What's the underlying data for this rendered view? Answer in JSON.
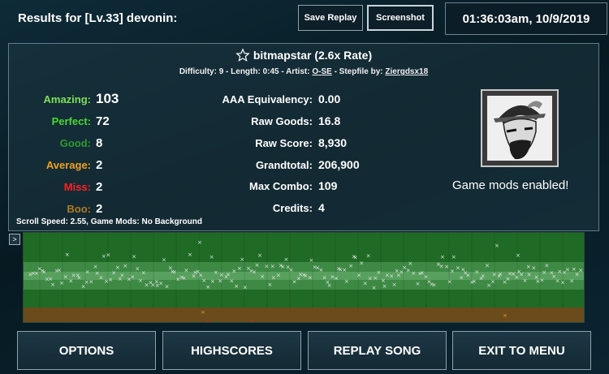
{
  "header": {
    "title": "Results for [Lv.33] devonin:",
    "save_replay_label": "Save Replay",
    "screenshot_label": "Screenshot",
    "datetime": "01:36:03am, 10/9/2019"
  },
  "song": {
    "name": "bitmapstar (2.6x Rate)",
    "meta_prefix": "Difficulty: 9 - Length: 0:45 - Artist:",
    "artist": "O-SE",
    "stepfile_prefix": "- Stepfile by:",
    "stepfile_author": "Ziergdsx18"
  },
  "judgements": [
    {
      "label": "Amazing:",
      "value": "103",
      "color": "#7fe05a"
    },
    {
      "label": "Perfect:",
      "value": "72",
      "color": "#4cd832"
    },
    {
      "label": "Good:",
      "value": "8",
      "color": "#2e9b2e"
    },
    {
      "label": "Average:",
      "value": "2",
      "color": "#f0a020"
    },
    {
      "label": "Miss:",
      "value": "2",
      "color": "#ff2020"
    },
    {
      "label": "Boo:",
      "value": "2",
      "color": "#b07a22"
    }
  ],
  "stats": [
    {
      "label": "AAA Equivalency:",
      "value": "0.00"
    },
    {
      "label": "Raw Goods:",
      "value": "16.8"
    },
    {
      "label": "Raw Score:",
      "value": "8,930"
    },
    {
      "label": "Grandtotal:",
      "value": "206,900"
    },
    {
      "label": "Max Combo:",
      "value": "109"
    },
    {
      "label": "Credits:",
      "value": "4"
    }
  ],
  "mods_text": "Game mods enabled!",
  "scroll_info": "Scroll Speed: 2.55, Game Mods: No Background",
  "expand_label": ">",
  "buttons": {
    "options": "OPTIONS",
    "highscores": "HIGHSCORES",
    "replay": "REPLAY SONG",
    "exit": "EXIT TO MENU"
  },
  "colors": {
    "graph_green": "#1f6b25",
    "graph_band": "#3e8a45",
    "graph_orange": "#6b4a1c",
    "marker_white": "#e8e8e8",
    "marker_orange": "#e0a020",
    "marker_red": "#e02020"
  }
}
